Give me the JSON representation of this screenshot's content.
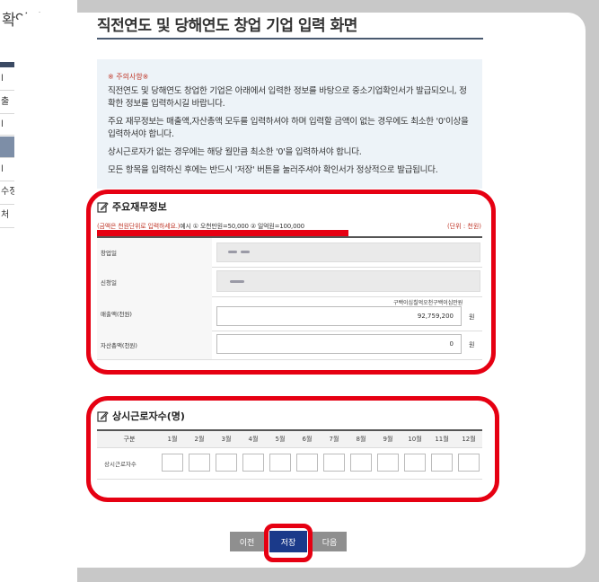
{
  "sidebar": {
    "title": "확인서",
    "items": [
      {
        "label": "l"
      },
      {
        "label": "출"
      },
      {
        "label": "l"
      },
      {
        "label": ""
      },
      {
        "label": "l"
      },
      {
        "label": "수정"
      },
      {
        "label": "처"
      }
    ],
    "plus": "+"
  },
  "page": {
    "title": "직전연도 및 당해연도 창업 기업 입력 화면"
  },
  "notice": {
    "heading": "※ 주의사항※",
    "lines": [
      "직전연도 및 당해연도 창업한 기업은 아래에서 입력한 정보를 바탕으로 중소기업확인서가 발급되오니, 정확한 정보를 입력하시길 바랍니다.",
      "주요 재무정보는 매출액,자산총액 모두를 입력하셔야 하며 입력할 금액이 없는 경우에도 최소한 '0'이상을 입력하셔야 합니다.",
      "상시근로자가 없는 경우에는 해당 월만큼 최소한 '0'을 입력하셔야 합니다.",
      "모든 항목을 입력하신 후에는 반드시 '저장' 버튼을 눌러주셔야 확인서가 정상적으로 발급됩니다."
    ]
  },
  "finance": {
    "title": "주요재무정보",
    "unit_note_red": "(금액은 천원단위로 입력하세요.)",
    "unit_note_rest": "예시 ① 오천만원=50,000 ② 일억원=100,000",
    "unit_right": "(단위 : 천원)",
    "rows": {
      "founding": {
        "label": "창업일"
      },
      "registration": {
        "label": "신청일"
      },
      "sales": {
        "label": "매출액(천원)",
        "korean": "구백이십칠억오천구백이십만원",
        "value": "92,759,200",
        "unit": "원"
      },
      "assets": {
        "label": "자산총액(천원)",
        "value": "0",
        "unit": "원"
      }
    }
  },
  "employees": {
    "title": "상시근로자수(명)",
    "header_label": "구분",
    "months": [
      "1월",
      "2월",
      "3월",
      "4월",
      "5월",
      "6월",
      "7월",
      "8월",
      "9월",
      "10월",
      "11월",
      "12월"
    ],
    "row_label": "상시근로자수"
  },
  "buttons": {
    "prev": "이전",
    "save": "저장",
    "next": "다음"
  },
  "colors": {
    "accent_red": "#e60012",
    "save_blue": "#1b3a8a",
    "title_line": "#4a5a70"
  }
}
